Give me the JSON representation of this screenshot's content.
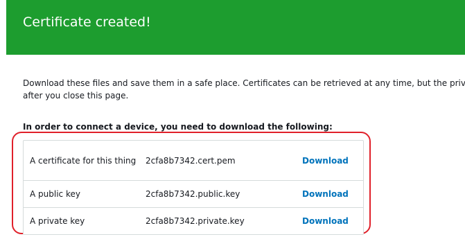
{
  "banner": {
    "title": "Certificate created!",
    "color": "#1d9d2f"
  },
  "intro": {
    "line1": "Download these files and save them in a safe place. Certificates can be retrieved at any time, but the private",
    "line2": "after you close this page."
  },
  "downloads": {
    "heading": "In order to connect a device, you need to download the following:",
    "rows": [
      {
        "label": "A certificate for this thing",
        "file": "2cfa8b7342.cert.pem",
        "action": "Download"
      },
      {
        "label": "A public key",
        "file": "2cfa8b7342.public.key",
        "action": "Download"
      },
      {
        "label": "A private key",
        "file": "2cfa8b7342.private.key",
        "action": "Download"
      }
    ]
  },
  "colors": {
    "link": "#0073bb",
    "highlight": "#e0202a"
  }
}
